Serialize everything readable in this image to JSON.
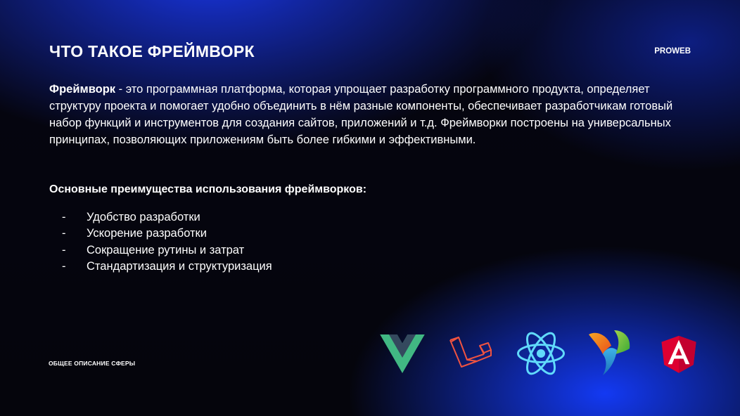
{
  "slide": {
    "title": "ЧТО ТАКОЕ ФРЕЙМВОРК",
    "brand": "PROWEB",
    "intro_term": "Фреймворк",
    "intro_text": " - это программная платформа, которая упрощает разработку программного продукта, определяет структуру проекта и помогает удобно объединить в нём разные компоненты, обеспечивает разработчикам готовый набор функций и инструментов для создания сайтов, приложений и т.д. Фреймворки построены на универсальных принципах, позволяющих приложениям быть более гибкими и эффективными.",
    "advantages_heading": "Основные преимущества использования фреймворков:",
    "advantages": [
      "Удобство разработки",
      "Ускорение разработки",
      "Сокращение рутины и затрат",
      "Стандартизация и структуризация"
    ],
    "dash": "-",
    "footer_label": "ОБЩЕЕ ОПИСАНИЕ СФЕРЫ",
    "logos": [
      "vue-logo",
      "laravel-logo",
      "react-logo",
      "yii-logo",
      "angular-logo"
    ],
    "colors": {
      "vue_green": "#41b883",
      "vue_dark": "#34495e",
      "laravel_red": "#f05340",
      "react_blue": "#61dafb",
      "angular_red": "#dd0031",
      "angular_dark": "#c3002f"
    }
  }
}
